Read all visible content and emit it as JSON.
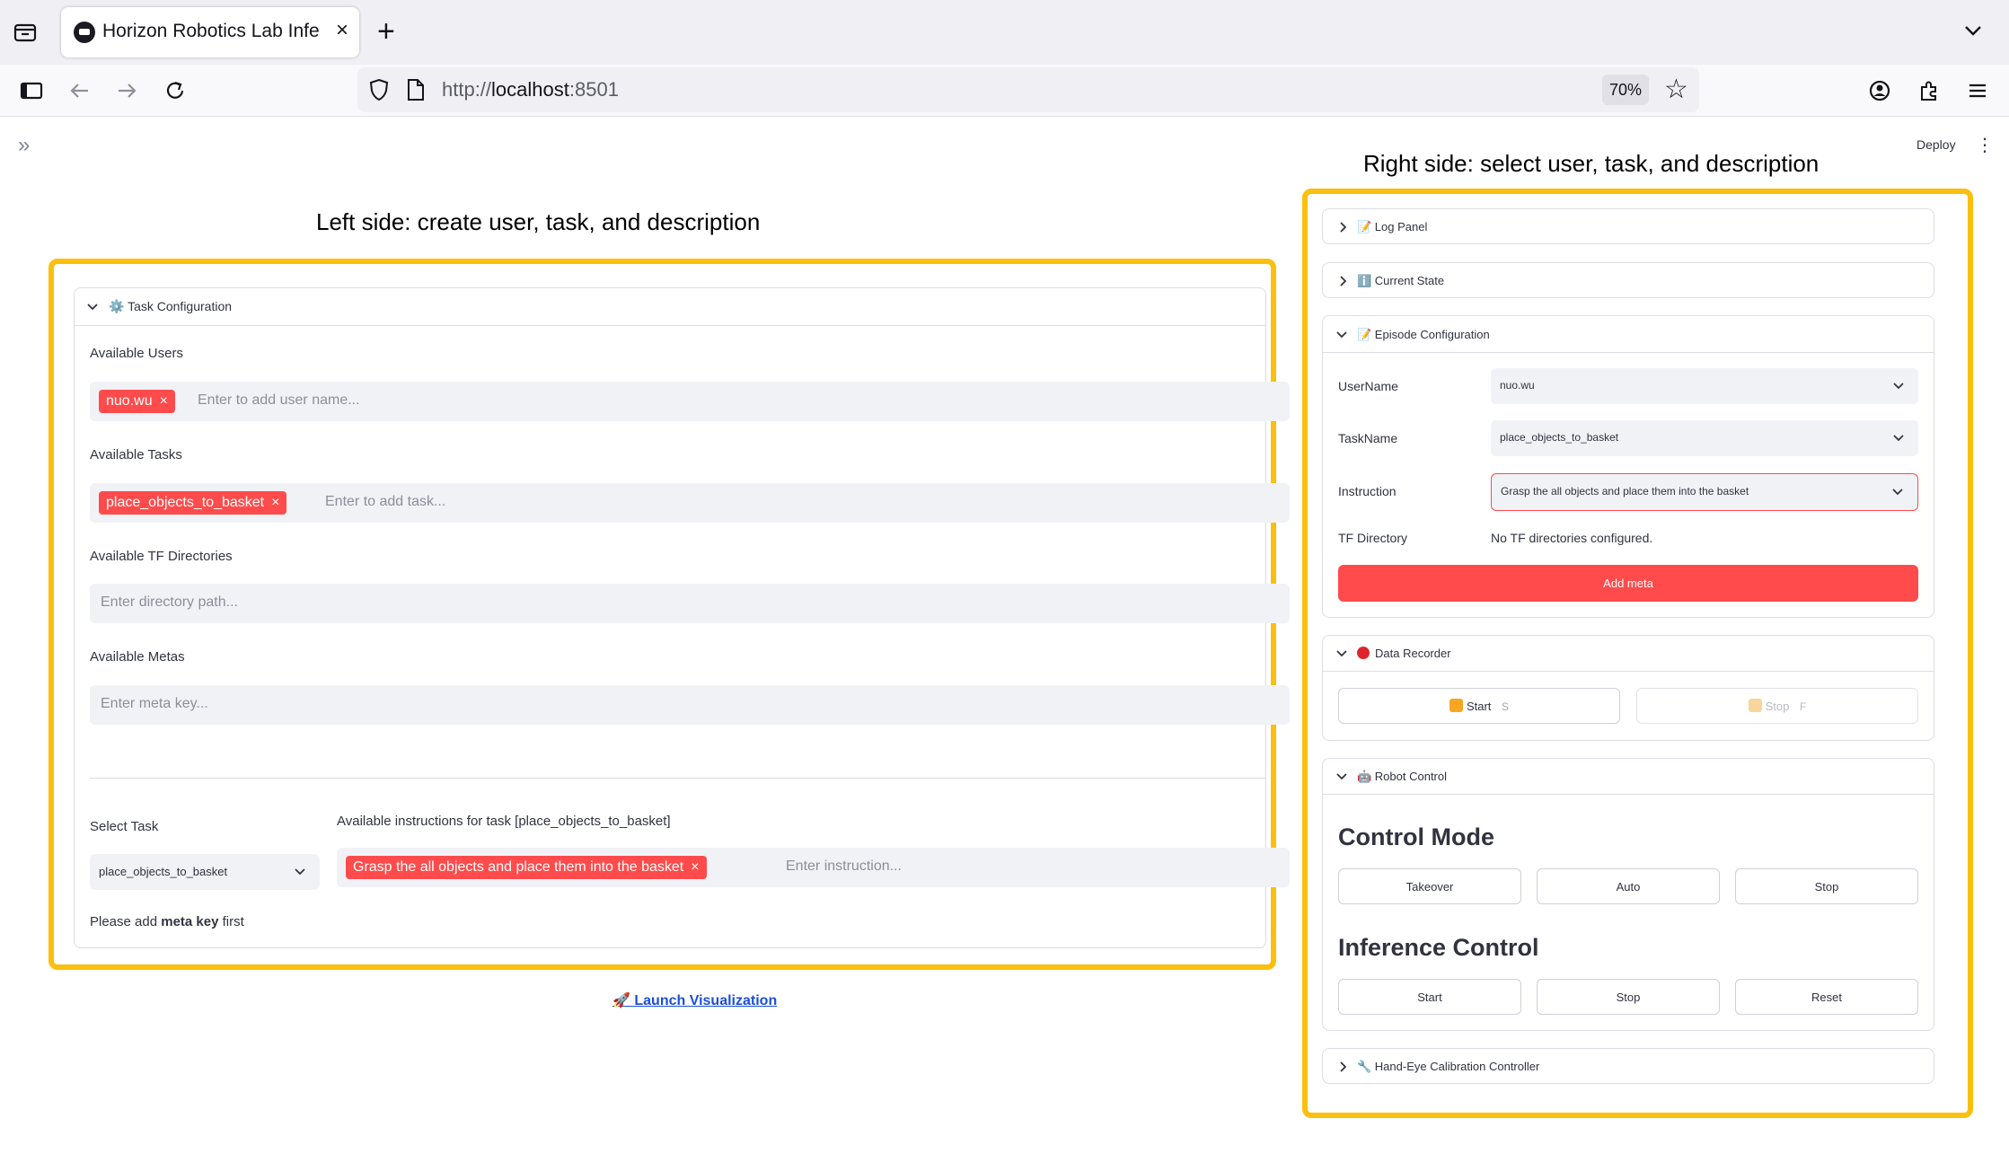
{
  "browser": {
    "tab_title": "Horizon Robotics Lab Infe",
    "tab_close": "×",
    "new_tab": "+",
    "url_prefix": "http://",
    "url_host": "localhost",
    "url_port": ":8501",
    "zoom": "70%"
  },
  "app_header": {
    "expand_sidebar": "»",
    "deploy": "Deploy",
    "menu": "⋮"
  },
  "annotations": {
    "left_caption": "Left side: create user, task, and description",
    "right_caption": "Right side: select user, task, and description",
    "box_color": "#fbbf0f"
  },
  "left_panel": {
    "expander_title": "⚙️ Task Configuration",
    "users": {
      "label": "Available Users",
      "tags": [
        "nuo.wu"
      ],
      "placeholder": "Enter to add user name..."
    },
    "tasks": {
      "label": "Available Tasks",
      "tags": [
        "place_objects_to_basket"
      ],
      "placeholder": "Enter to add task..."
    },
    "tf_dirs": {
      "label": "Available TF Directories",
      "placeholder": "Enter directory path..."
    },
    "metas": {
      "label": "Available Metas",
      "placeholder": "Enter meta key..."
    },
    "select_task": {
      "label": "Select Task",
      "value": "place_objects_to_basket"
    },
    "instructions": {
      "label": "Available instructions for task [place_objects_to_basket]",
      "tags": [
        "Grasp the all objects and place them into the basket"
      ],
      "placeholder": "Enter instruction..."
    },
    "meta_notice_prefix": "Please add ",
    "meta_notice_bold": "meta key",
    "meta_notice_suffix": " first",
    "tag_x": "×",
    "launch_link": "🚀 Launch Visualization"
  },
  "right_panel": {
    "log_panel": "📝 Log Panel",
    "current_state": "ℹ️ Current State",
    "episode_config": "📝 Episode Configuration",
    "username_label": "UserName",
    "username_value": "nuo.wu",
    "taskname_label": "TaskName",
    "taskname_value": "place_objects_to_basket",
    "instruction_label": "Instruction",
    "instruction_value": "Grasp the all objects and place them into the basket",
    "tf_label": "TF Directory",
    "tf_value": "No TF directories configured.",
    "add_meta": "Add meta",
    "data_recorder": "Data Recorder",
    "recorder_start": "Start",
    "recorder_start_key": "S",
    "recorder_stop": "Stop",
    "recorder_stop_key": "F",
    "robot_control": "🤖 Robot Control",
    "control_mode": "Control Mode",
    "takeover": "Takeover",
    "auto": "Auto",
    "control_stop": "Stop",
    "inference_control": "Inference Control",
    "inf_start": "Start",
    "inf_stop": "Stop",
    "inf_reset": "Reset",
    "hand_eye": "🔧 Hand-Eye Calibration Controller"
  },
  "colors": {
    "primary": "#ff4b4b",
    "input_bg": "#f0f2f6",
    "link": "#1c4fd9"
  }
}
